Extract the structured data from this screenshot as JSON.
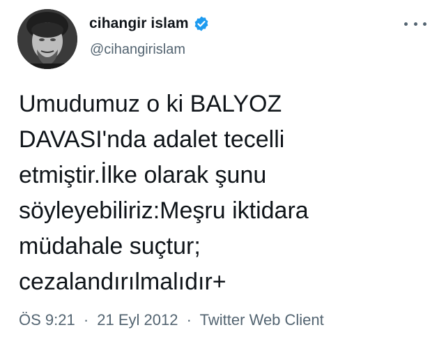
{
  "author": {
    "display_name": "cihangir islam",
    "handle": "@cihangirislam",
    "verified": true,
    "avatar_icon": "profile-photo",
    "verified_icon": "verified-badge-icon"
  },
  "tweet": {
    "lines": [
      "Umudumuz o ki BALYOZ",
      "DAVASI'nda adalet tecelli",
      "etmiştir.İlke olarak şunu",
      "söyleyebiliriz:Meşru iktidara",
      "müdahale suçtur;",
      "cezalandırılmalıdır+"
    ]
  },
  "meta": {
    "time": "ÖS 9:21",
    "separator": "·",
    "date": "21 Eyl 2012",
    "client": "Twitter Web Client"
  },
  "colors": {
    "text": "#0f1419",
    "secondary": "#536471",
    "verified": "#1d9bf0"
  },
  "menu": {
    "icon": "more-dots-icon"
  }
}
